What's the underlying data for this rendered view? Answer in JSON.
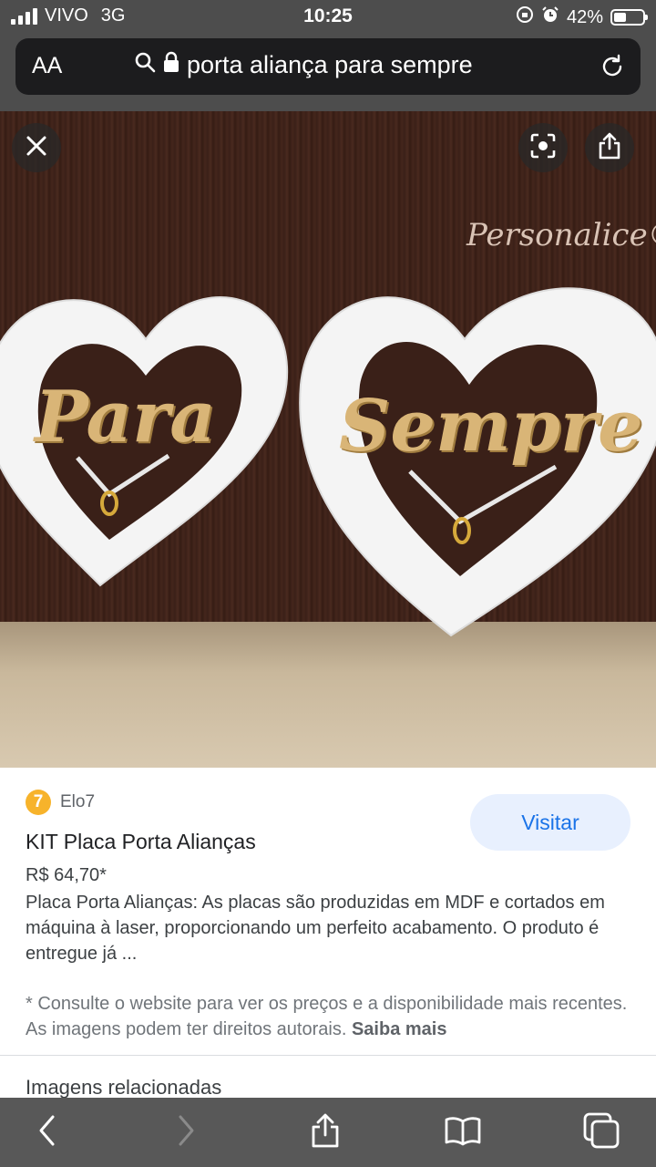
{
  "status_bar": {
    "carrier": "VIVO",
    "network": "3G",
    "time": "10:25",
    "battery_percent": "42%",
    "battery_level": 0.42
  },
  "address_bar": {
    "text_size_label": "AA",
    "query": "porta aliança para sempre"
  },
  "image": {
    "watermark": "Personalice®"
  },
  "result": {
    "source_logo": "7",
    "source_name": "Elo7",
    "visit_label": "Visitar",
    "title": "KIT Placa Porta Alianças",
    "price": "R$ 64,70*",
    "description": "Placa Porta Alianças: As placas são produzidas em MDF e cortados em máquina à laser, proporcionando um perfeito acabamento. O produto é entregue já ...",
    "disclaimer": "* Consulte o website para ver os preços e a disponibilidade mais recentes. As imagens podem ter direitos autorais.",
    "learn_more": "Saiba mais",
    "related_heading": "Imagens relacionadas"
  },
  "colors": {
    "chrome": "#4d4d4d",
    "accent": "#1a73e8",
    "visit_bg": "#e8f0fe"
  }
}
